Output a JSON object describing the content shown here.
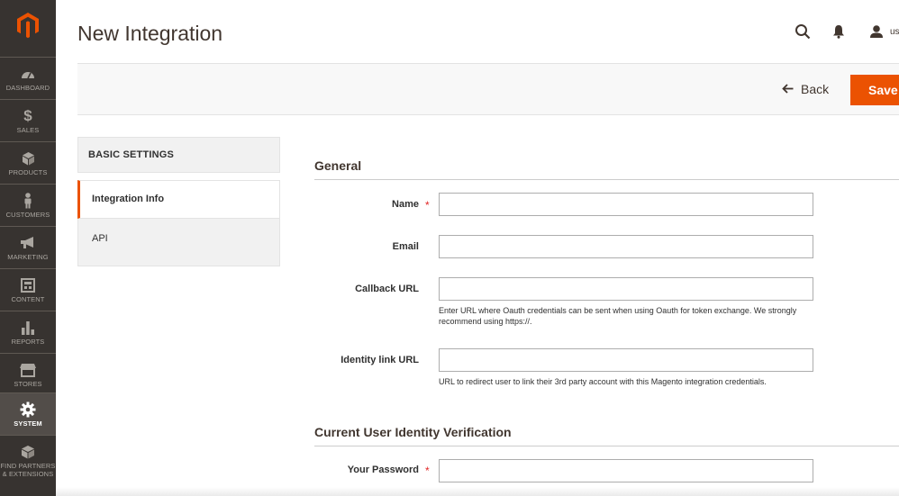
{
  "colors": {
    "sidebar_bg": "#373330",
    "accent": "#eb5202",
    "required": "#e22626"
  },
  "sidebar": {
    "logo_icon": "magento-logo-icon",
    "items": [
      {
        "label": "DASHBOARD",
        "icon": "speedometer-icon"
      },
      {
        "label": "SALES",
        "icon": "dollar-icon"
      },
      {
        "label": "PRODUCTS",
        "icon": "cube-icon"
      },
      {
        "label": "CUSTOMERS",
        "icon": "person-icon"
      },
      {
        "label": "MARKETING",
        "icon": "megaphone-icon"
      },
      {
        "label": "CONTENT",
        "icon": "layout-icon"
      },
      {
        "label": "REPORTS",
        "icon": "bar-chart-icon"
      },
      {
        "label": "STORES",
        "icon": "storefront-icon"
      },
      {
        "label": "SYSTEM",
        "icon": "gear-icon",
        "active": true
      },
      {
        "label": "FIND PARTNERS & EXTENSIONS",
        "icon": "box-icon"
      }
    ]
  },
  "header": {
    "title": "New Integration",
    "search_icon": "search-icon",
    "notification_icon": "bell-icon",
    "user_icon": "user-icon",
    "user_label": "us"
  },
  "action_bar": {
    "back_label": "Back",
    "save_label": "Save"
  },
  "tabs": {
    "header": "BASIC SETTINGS",
    "items": [
      {
        "label": "Integration Info",
        "active": true
      },
      {
        "label": "API",
        "active": false
      }
    ]
  },
  "form": {
    "general": {
      "title": "General",
      "fields": {
        "name": {
          "label": "Name",
          "value": "",
          "required": true
        },
        "email": {
          "label": "Email",
          "value": ""
        },
        "callback_url": {
          "label": "Callback URL",
          "value": "",
          "note": "Enter URL where Oauth credentials can be sent when using Oauth for token exchange. We strongly recommend using https://."
        },
        "identity_link_url": {
          "label": "Identity link URL",
          "value": "",
          "note": "URL to redirect user to link their 3rd party account with this Magento integration credentials."
        }
      }
    },
    "verification": {
      "title": "Current User Identity Verification",
      "fields": {
        "password": {
          "label": "Your Password",
          "value": "",
          "required": true
        }
      }
    }
  }
}
